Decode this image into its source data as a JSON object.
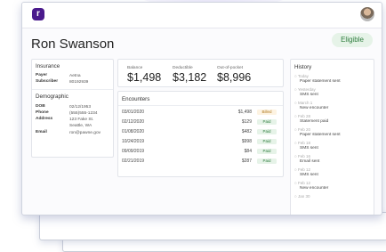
{
  "app": {
    "logo_letter": "r"
  },
  "patient": {
    "name": "Ron Swanson",
    "status": "Eligible"
  },
  "insurance": {
    "title": "Insurance",
    "rows": [
      {
        "label": "Payer",
        "value": "Aetna"
      },
      {
        "label": "Subscriber",
        "value": "80192939"
      }
    ]
  },
  "demographic": {
    "title": "Demographic",
    "rows": [
      {
        "label": "DOB",
        "value": "02/12/1953"
      },
      {
        "label": "Phone",
        "value": "(555)555-1234"
      },
      {
        "label": "Address",
        "value": "123 Fake St.\nSeattle, WA"
      },
      {
        "label": "Email",
        "value": "ron@pawne.gov"
      }
    ]
  },
  "summary": {
    "items": [
      {
        "label": "Balance",
        "value": "$1,498"
      },
      {
        "label": "Deductible",
        "value": "$3,182"
      },
      {
        "label": "Out-of-pocket",
        "value": "$8,996"
      }
    ]
  },
  "encounters": {
    "title": "Encounters",
    "rows": [
      {
        "date": "03/01/2020",
        "amount": "$1,498",
        "status": "Billed"
      },
      {
        "date": "02/12/2020",
        "amount": "$129",
        "status": "Paid"
      },
      {
        "date": "01/08/2020",
        "amount": "$482",
        "status": "Paid"
      },
      {
        "date": "10/24/2019",
        "amount": "$998",
        "status": "Paid"
      },
      {
        "date": "09/09/2019",
        "amount": "$84",
        "status": "Paid"
      },
      {
        "date": "02/21/2019",
        "amount": "$287",
        "status": "Paid"
      }
    ]
  },
  "history": {
    "title": "History",
    "items": [
      {
        "date": "Today",
        "event": "Paper statement sent"
      },
      {
        "date": "Yesterday",
        "event": "SMS sent"
      },
      {
        "date": "March 1",
        "event": "New encounter"
      },
      {
        "date": "Feb 28",
        "event": "Statement paid"
      },
      {
        "date": "Feb 20",
        "event": "Paper statement sent"
      },
      {
        "date": "Feb 18",
        "event": "SMS sent"
      },
      {
        "date": "Feb 16",
        "event": "Email sent"
      },
      {
        "date": "Feb 12",
        "event": "SMS sent"
      },
      {
        "date": "Feb 12",
        "event": "New encounter"
      },
      {
        "date": "Jan 30",
        "event": ""
      }
    ]
  },
  "colors": {
    "brand": "#4a1a8c",
    "eligible_bg": "#e6f3e8",
    "eligible_fg": "#2e7d3e",
    "billed_fg": "#b07a20"
  }
}
